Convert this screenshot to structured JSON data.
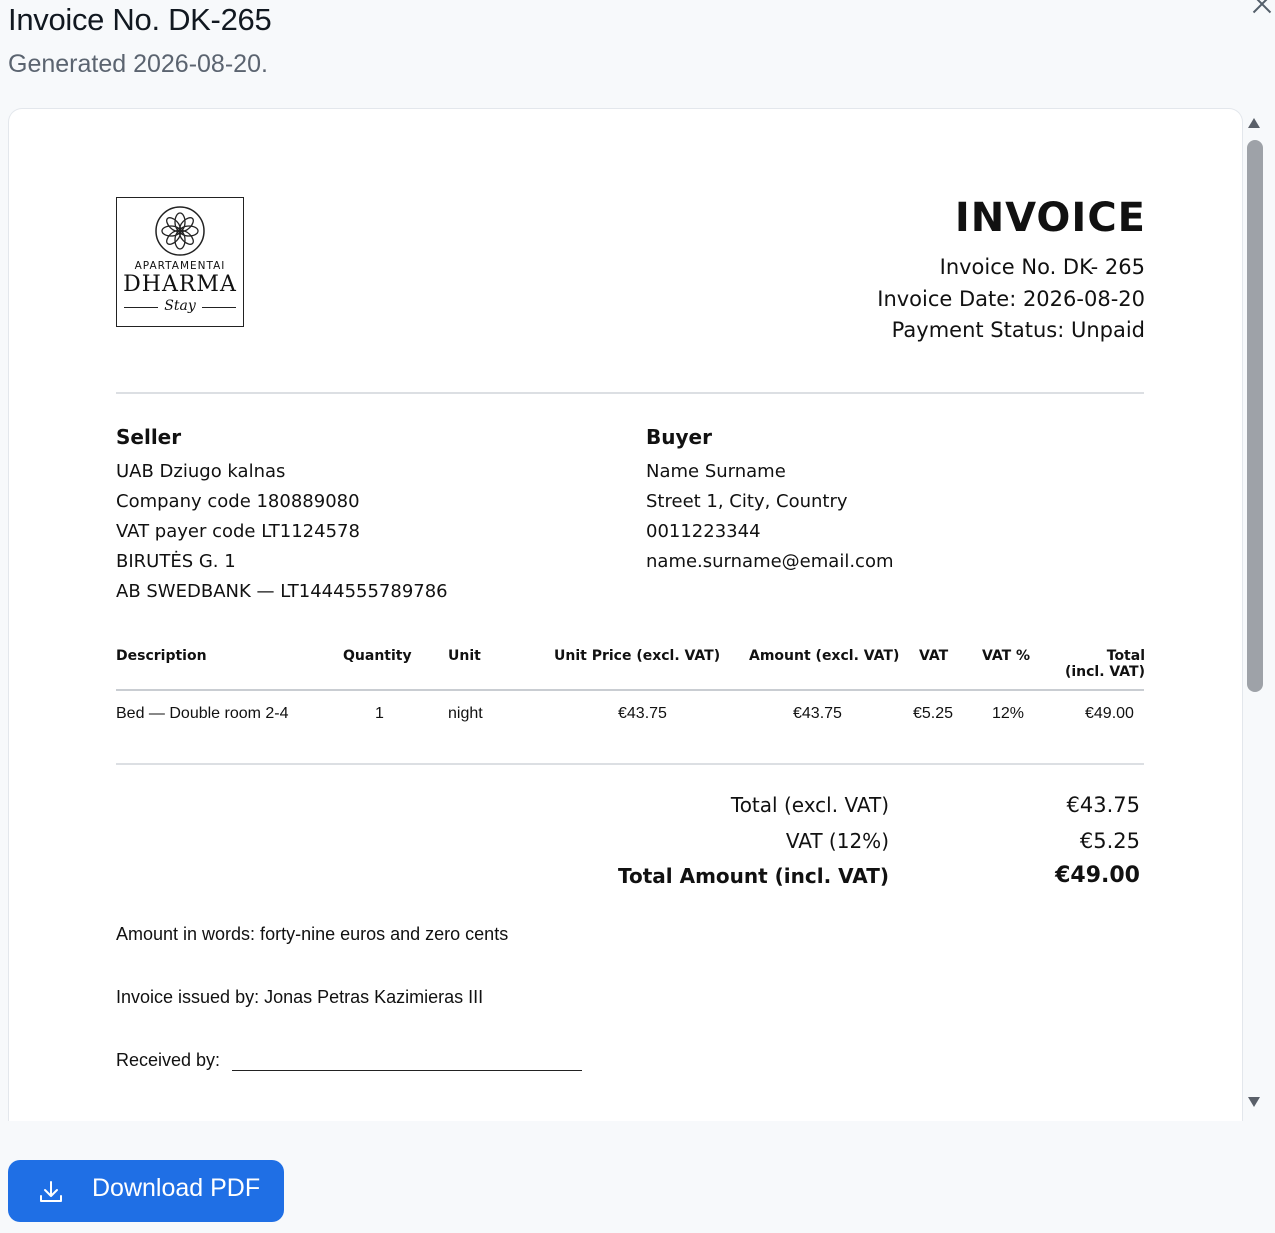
{
  "modal": {
    "title": "Invoice No. DK-265",
    "subtitle": "Generated 2026-08-20.",
    "download_label": "Download PDF",
    "accent_color": "#1f6fe5"
  },
  "invoice": {
    "logo": {
      "top": "APARTAMENTAI",
      "name": "DHARMA",
      "script": "Stay"
    },
    "heading": "INVOICE",
    "number_line": "Invoice No. DK- 265",
    "date_line": "Invoice Date: 2026-08-20",
    "status_line": "Payment Status: Unpaid",
    "seller": {
      "title": "Seller",
      "lines": [
        "UAB Dziugo kalnas",
        "Company code 180889080",
        "VAT payer code LT1124578",
        "BIRUTĖS G. 1",
        "AB SWEDBANK — LT1444555789786"
      ]
    },
    "buyer": {
      "title": "Buyer",
      "lines": [
        "Name Surname",
        "Street 1, City, Country",
        "0011223344",
        "name.surname@email.com"
      ]
    },
    "table": {
      "headers": [
        "Description",
        "Quantity",
        "Unit",
        "Unit Price (excl. VAT)",
        "Amount (excl. VAT)",
        "VAT",
        "VAT %",
        "Total",
        "(incl. VAT)"
      ],
      "rows": [
        [
          "Bed — Double room 2-4",
          "1",
          "night",
          "€43.75",
          "€43.75",
          "€5.25",
          "12%",
          "€49.00"
        ]
      ]
    },
    "totals": [
      {
        "label": "Total (excl. VAT)",
        "value": "€43.75"
      },
      {
        "label": "VAT (12%)",
        "value": "€5.25"
      },
      {
        "label": "Total Amount (incl. VAT)",
        "value": "€49.00"
      }
    ],
    "amount_in_words": "Amount in words: forty-nine euros and zero cents",
    "issued_by": "Invoice issued by: Jonas Petras Kazimieras III",
    "received_by": "Received by:"
  }
}
